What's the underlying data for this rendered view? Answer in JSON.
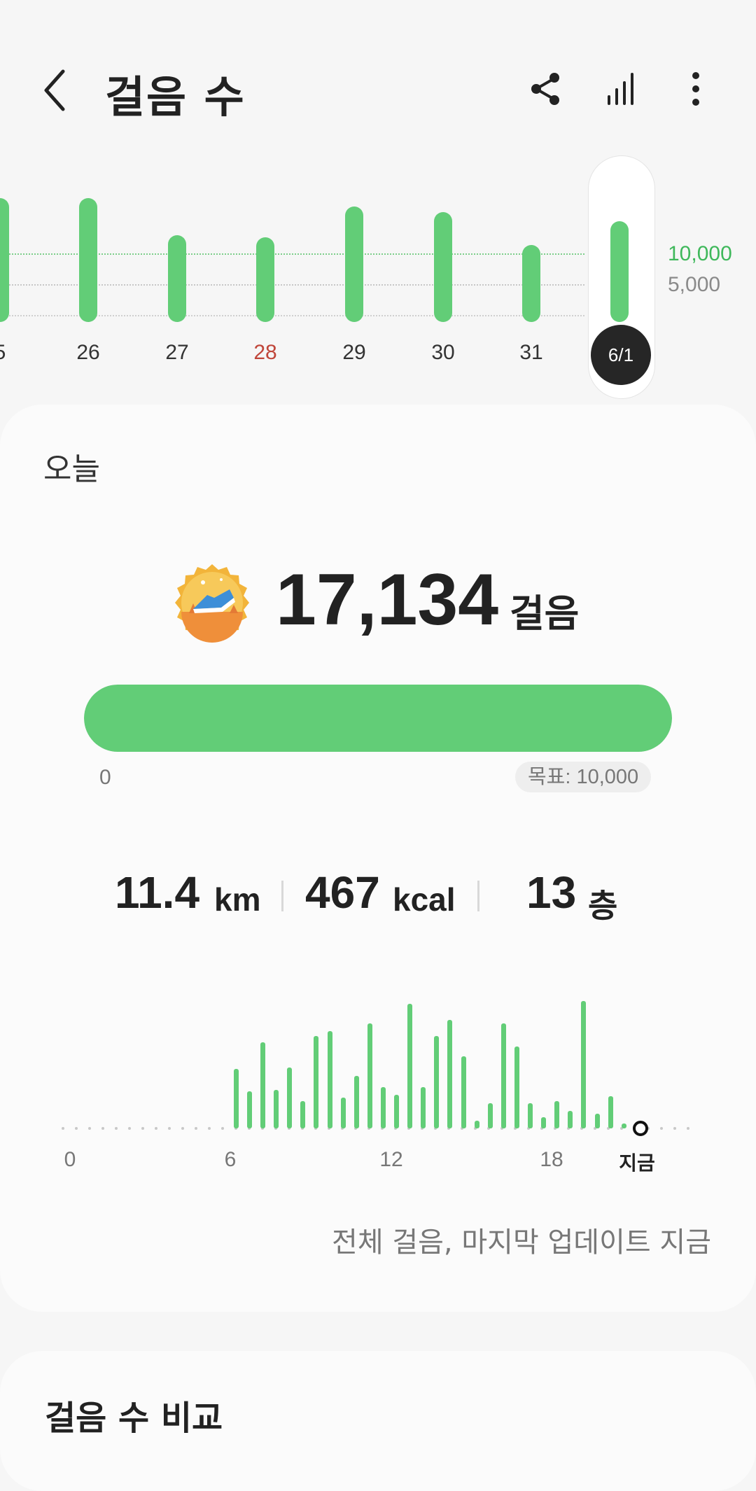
{
  "header": {
    "title": "걸음 수",
    "icons": [
      "back-icon",
      "share-icon",
      "bar-chart-icon",
      "more-vertical-icon"
    ]
  },
  "week": {
    "goal_label": "10,000",
    "mid_label": "5,000",
    "days": [
      {
        "label": "5",
        "steps": 14500,
        "highlight": false
      },
      {
        "label": "26",
        "steps": 14500,
        "highlight": false
      },
      {
        "label": "27",
        "steps": 10200,
        "highlight": false
      },
      {
        "label": "28",
        "steps": 9900,
        "highlight": true
      },
      {
        "label": "29",
        "steps": 13500,
        "highlight": false
      },
      {
        "label": "30",
        "steps": 12900,
        "highlight": false
      },
      {
        "label": "31",
        "steps": 9000,
        "highlight": false
      },
      {
        "label": "6/1",
        "steps": 11800,
        "selected": true
      }
    ],
    "accent": "#62cd77",
    "weekend_color": "#c0463a"
  },
  "today": {
    "label": "오늘",
    "steps": "17,134",
    "unit": "걸음",
    "medal_icon": "running-shoe-medal-icon",
    "progress": 1.0,
    "progress_start": "0",
    "goal": "목표: 10,000",
    "stats": [
      {
        "value": "11.4",
        "unit": "km"
      },
      {
        "value": "467",
        "unit": "kcal"
      },
      {
        "value": "13",
        "unit": "층"
      }
    ]
  },
  "hourly": {
    "axis_labels": [
      "0",
      "6",
      "12",
      "18",
      "지금"
    ],
    "bars": [
      {
        "hour": 6.2,
        "value": 0.48
      },
      {
        "hour": 6.7,
        "value": 0.3
      },
      {
        "hour": 7.2,
        "value": 0.69
      },
      {
        "hour": 7.7,
        "value": 0.31
      },
      {
        "hour": 8.2,
        "value": 0.49
      },
      {
        "hour": 8.7,
        "value": 0.22
      },
      {
        "hour": 9.2,
        "value": 0.74
      },
      {
        "hour": 9.7,
        "value": 0.78
      },
      {
        "hour": 10.2,
        "value": 0.25
      },
      {
        "hour": 10.7,
        "value": 0.42
      },
      {
        "hour": 11.2,
        "value": 0.84
      },
      {
        "hour": 11.7,
        "value": 0.33
      },
      {
        "hour": 12.2,
        "value": 0.27
      },
      {
        "hour": 12.7,
        "value": 1.0
      },
      {
        "hour": 13.2,
        "value": 0.33
      },
      {
        "hour": 13.7,
        "value": 0.74
      },
      {
        "hour": 14.2,
        "value": 0.87
      },
      {
        "hour": 14.7,
        "value": 0.58
      },
      {
        "hour": 15.2,
        "value": 0.06
      },
      {
        "hour": 15.7,
        "value": 0.2
      },
      {
        "hour": 16.2,
        "value": 0.84
      },
      {
        "hour": 16.7,
        "value": 0.66
      },
      {
        "hour": 17.2,
        "value": 0.2
      },
      {
        "hour": 17.7,
        "value": 0.09
      },
      {
        "hour": 18.2,
        "value": 0.22
      },
      {
        "hour": 18.7,
        "value": 0.14
      },
      {
        "hour": 19.2,
        "value": 1.02
      },
      {
        "hour": 19.7,
        "value": 0.12
      },
      {
        "hour": 20.2,
        "value": 0.26
      },
      {
        "hour": 20.7,
        "value": 0.04
      }
    ],
    "updated_text": "전체 걸음, 마지막 업데이트 지금"
  },
  "compare": {
    "title": "걸음 수 비교"
  }
}
